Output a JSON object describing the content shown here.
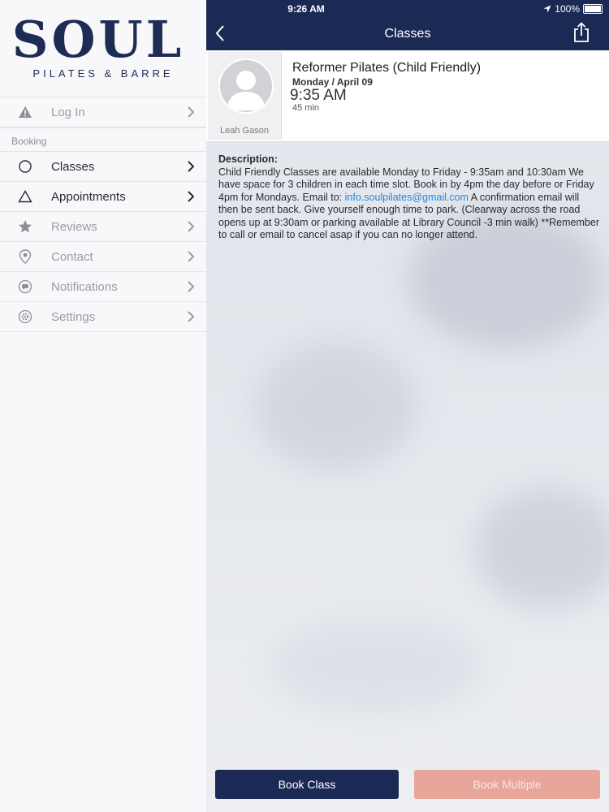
{
  "logo": {
    "main": "SOUL",
    "sub": "PILATES & BARRE"
  },
  "sidebar": {
    "login": {
      "label": "Log In",
      "icon": "warning-icon"
    },
    "section_label": "Booking",
    "items": [
      {
        "label": "Classes",
        "icon": "circle-icon",
        "active": true
      },
      {
        "label": "Appointments",
        "icon": "triangle-icon",
        "active": true
      },
      {
        "label": "Reviews",
        "icon": "star-icon",
        "active": false
      },
      {
        "label": "Contact",
        "icon": "location-pin-icon",
        "active": false
      },
      {
        "label": "Notifications",
        "icon": "chat-bubble-icon",
        "active": false
      },
      {
        "label": "Settings",
        "icon": "gear-icon",
        "active": false
      }
    ]
  },
  "status_bar": {
    "time": "9:26 AM",
    "battery": "100%"
  },
  "nav": {
    "title": "Classes"
  },
  "class": {
    "instructor": "Leah Gason",
    "title": "Reformer Pilates (Child Friendly)",
    "date": "Monday / April 09",
    "time": "9:35 AM",
    "duration": "45 min"
  },
  "description": {
    "label": "Description:",
    "text_before_link": "Child Friendly Classes are available Monday to Friday  - 9:35am and 10:30am We have space for 3 children in each time slot. Book in by 4pm the day before or Friday 4pm for Mondays. Email to:  ",
    "link": "info.soulpilates@gmail.com",
    "text_after_link": "  A confirmation email will then be sent back. Give yourself enough time to park. (Clearway across the road opens up at 9:30am or parking available at Library Council -3 min walk) **Remember to call or email to cancel asap if you can no longer attend."
  },
  "buttons": {
    "book_class": "Book Class",
    "book_multiple": "Book Multiple"
  },
  "colors": {
    "brand": "#1b2a55",
    "accent": "#e8a69b",
    "link": "#2b86d6"
  }
}
